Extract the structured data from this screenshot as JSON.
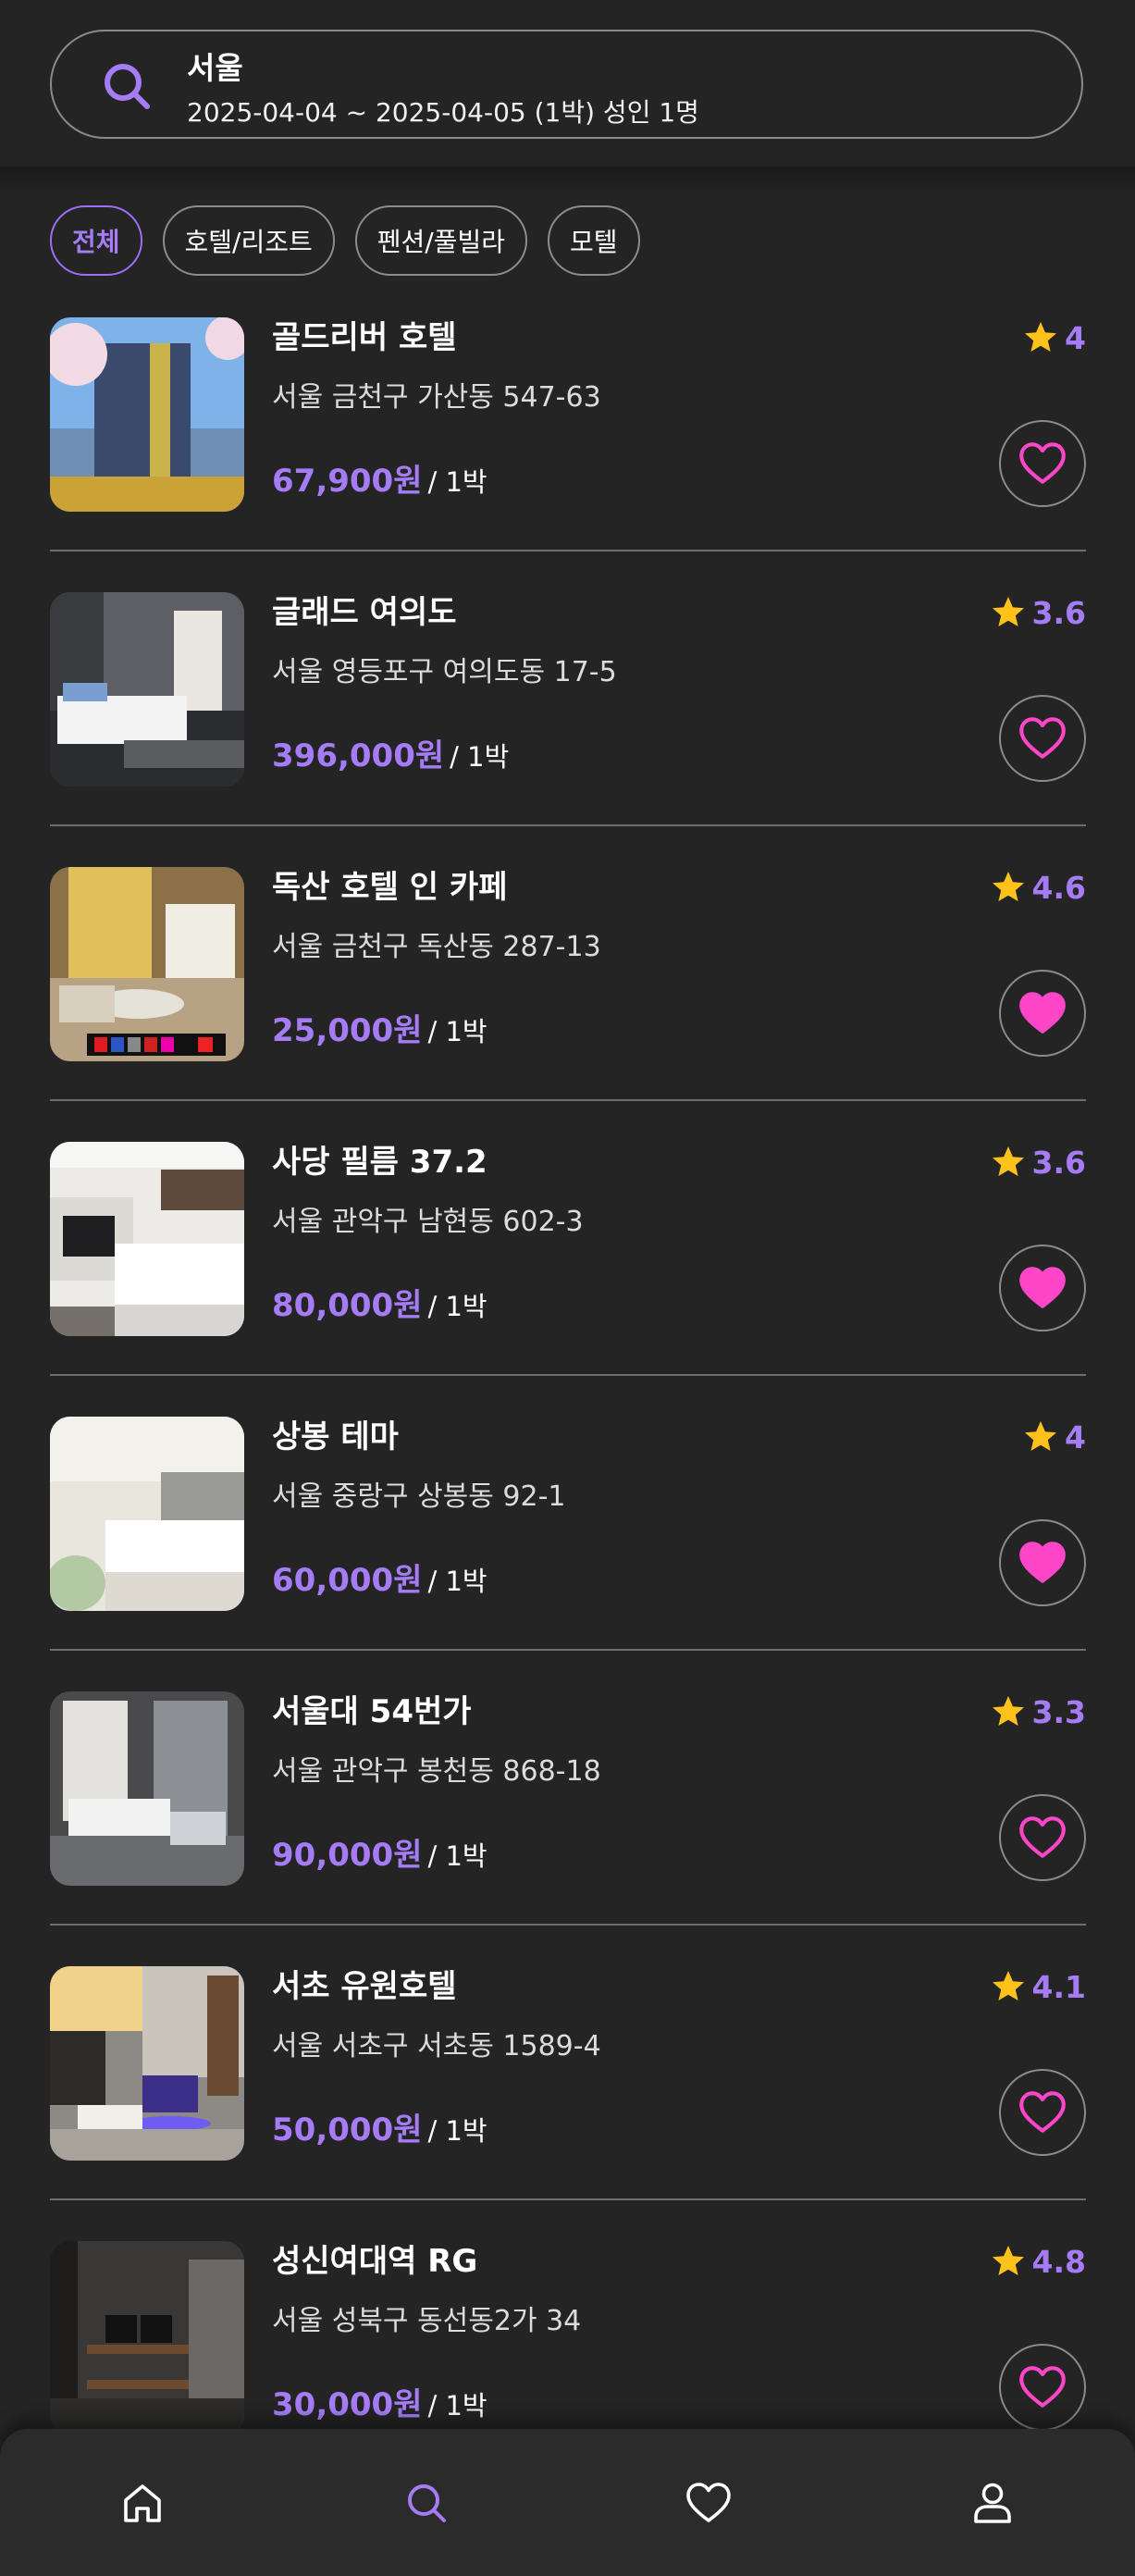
{
  "search": {
    "city": "서울",
    "detail": "2025-04-04 ~ 2025-04-05 (1박) 성인 1명",
    "icon": "search-icon"
  },
  "filters": [
    "전체",
    "호텔/리조트",
    "펜션/풀빌라",
    "모텔"
  ],
  "active_filter": "전체",
  "per_night": "/ 1박",
  "items": [
    {
      "name": "골드리버 호텔",
      "address": "서울 금천구 가산동 547-63",
      "price": "67,900원",
      "rating": "4",
      "liked": false
    },
    {
      "name": "글래드 여의도",
      "address": "서울 영등포구 여의도동 17-5",
      "price": "396,000원",
      "rating": "3.6",
      "liked": false
    },
    {
      "name": "독산 호텔 인 카페",
      "address": "서울 금천구 독산동 287-13",
      "price": "25,000원",
      "rating": "4.6",
      "liked": true
    },
    {
      "name": "사당 필름 37.2",
      "address": "서울 관악구 남현동 602-3",
      "price": "80,000원",
      "rating": "3.6",
      "liked": true
    },
    {
      "name": "상봉 테마",
      "address": "서울 중랑구 상봉동 92-1",
      "price": "60,000원",
      "rating": "4",
      "liked": true
    },
    {
      "name": "서울대 54번가",
      "address": "서울 관악구 봉천동 868-18",
      "price": "90,000원",
      "rating": "3.3",
      "liked": false
    },
    {
      "name": "서초 유원호텔",
      "address": "서울 서초구 서초동 1589-4",
      "price": "50,000원",
      "rating": "4.1",
      "liked": false
    },
    {
      "name": "성신여대역 RG",
      "address": "서울 성북구 동선동2가 34",
      "price": "30,000원",
      "rating": "4.8",
      "liked": false
    }
  ],
  "nav": [
    {
      "icon": "home-icon",
      "active": false
    },
    {
      "icon": "search-icon",
      "active": true
    },
    {
      "icon": "heart-icon",
      "active": false
    },
    {
      "icon": "user-icon",
      "active": false
    }
  ],
  "colors": {
    "background": "#242424",
    "accent": "#a57cf6",
    "star": "#ffc21a",
    "heart": "#ff45c8",
    "divider": "#6e6e6e"
  }
}
